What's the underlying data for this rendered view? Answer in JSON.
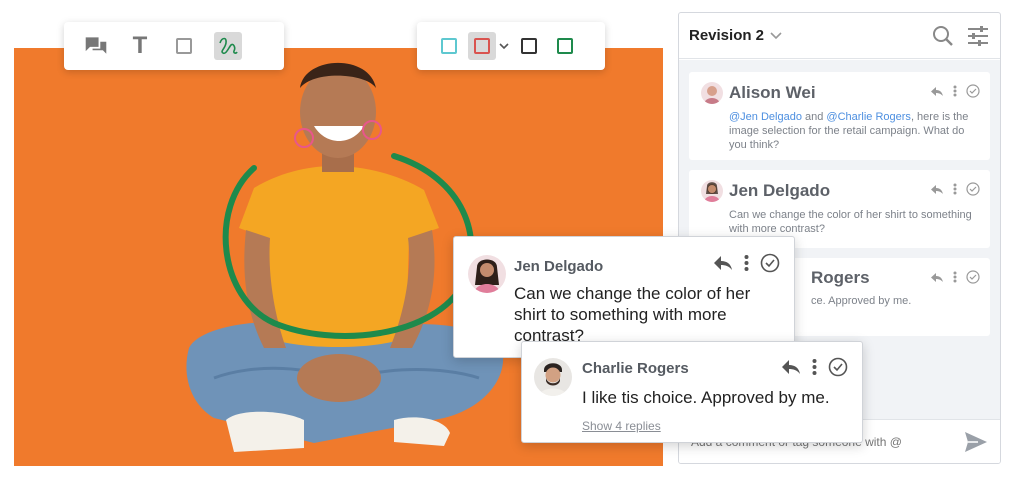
{
  "toolbar_left": {
    "tools": [
      {
        "name": "comment-tool",
        "icon": "speech-bubbles-icon"
      },
      {
        "name": "text-tool",
        "icon": "text-T-icon",
        "label": "T"
      },
      {
        "name": "rectangle-tool",
        "icon": "square-outline-icon"
      },
      {
        "name": "freehand-tool",
        "icon": "squiggle-icon",
        "active": true
      }
    ]
  },
  "toolbar_right": {
    "swatches": [
      {
        "name": "teal",
        "color": "#5ec8d0"
      },
      {
        "name": "red",
        "color": "#d9534f",
        "active": true
      },
      {
        "name": "black",
        "color": "#333333"
      },
      {
        "name": "green",
        "color": "#1e8a4c"
      }
    ]
  },
  "colors": {
    "photo_bg": "#f07a2c",
    "annotation_stroke": "#1e8a4c",
    "mention": "#4d8fe0"
  },
  "panel": {
    "title": "Revision 2",
    "comments": [
      {
        "author": "Alison Wei",
        "mention1": "@Jen Delgado",
        "joiner": " and ",
        "mention2": "@Charlie Rogers",
        "text": ", here is the image selection for the retail campaign. What do you think?"
      },
      {
        "author": "Jen Delgado",
        "text": "Can we change the color of her shirt to something with more contrast?"
      },
      {
        "author": "Rogers",
        "text": "ce. Approved by me."
      }
    ],
    "input_placeholder": "Add a comment or tag someone with @"
  },
  "popups": [
    {
      "author": "Jen Delgado",
      "text": "Can we change the color of her shirt to something with more contrast?"
    },
    {
      "author": "Charlie Rogers",
      "text": "I like tis choice. Approved by me.",
      "replies": "Show 4 replies"
    }
  ]
}
